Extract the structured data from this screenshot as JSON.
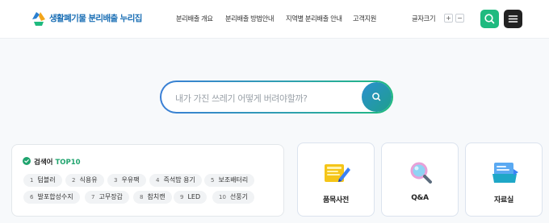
{
  "header": {
    "logo_text": "생활폐기물 분리배출 누리집",
    "nav": [
      "분리배출 개요",
      "분리배출 방법안내",
      "지역별 분리배출 안내",
      "고객지원"
    ],
    "font_size_label": "글자크기",
    "font_plus": "+",
    "font_minus": "−"
  },
  "search": {
    "placeholder": "내가 가진 쓰레기 어떻게 버려야할까?"
  },
  "keywords": {
    "title_prefix": "검색어",
    "title_accent": "TOP10",
    "items": [
      {
        "rank": "1",
        "label": "텀블러"
      },
      {
        "rank": "2",
        "label": "식용유"
      },
      {
        "rank": "3",
        "label": "우유팩"
      },
      {
        "rank": "4",
        "label": "즉석밥 용기"
      },
      {
        "rank": "5",
        "label": "보조배터리"
      },
      {
        "rank": "6",
        "label": "발포합성수지"
      },
      {
        "rank": "7",
        "label": "고무장갑"
      },
      {
        "rank": "8",
        "label": "참치캔"
      },
      {
        "rank": "9",
        "label": "LED"
      },
      {
        "rank": "10",
        "label": "선풍기"
      }
    ]
  },
  "categories": [
    {
      "label": "품목사전",
      "icon": "notebook-pencil-icon"
    },
    {
      "label": "Q&A",
      "icon": "magnifier-icon"
    },
    {
      "label": "자료실",
      "icon": "folder-icon"
    }
  ],
  "colors": {
    "accent_green": "#1fba7f",
    "accent_blue": "#1b6fb5",
    "dark": "#222222"
  }
}
